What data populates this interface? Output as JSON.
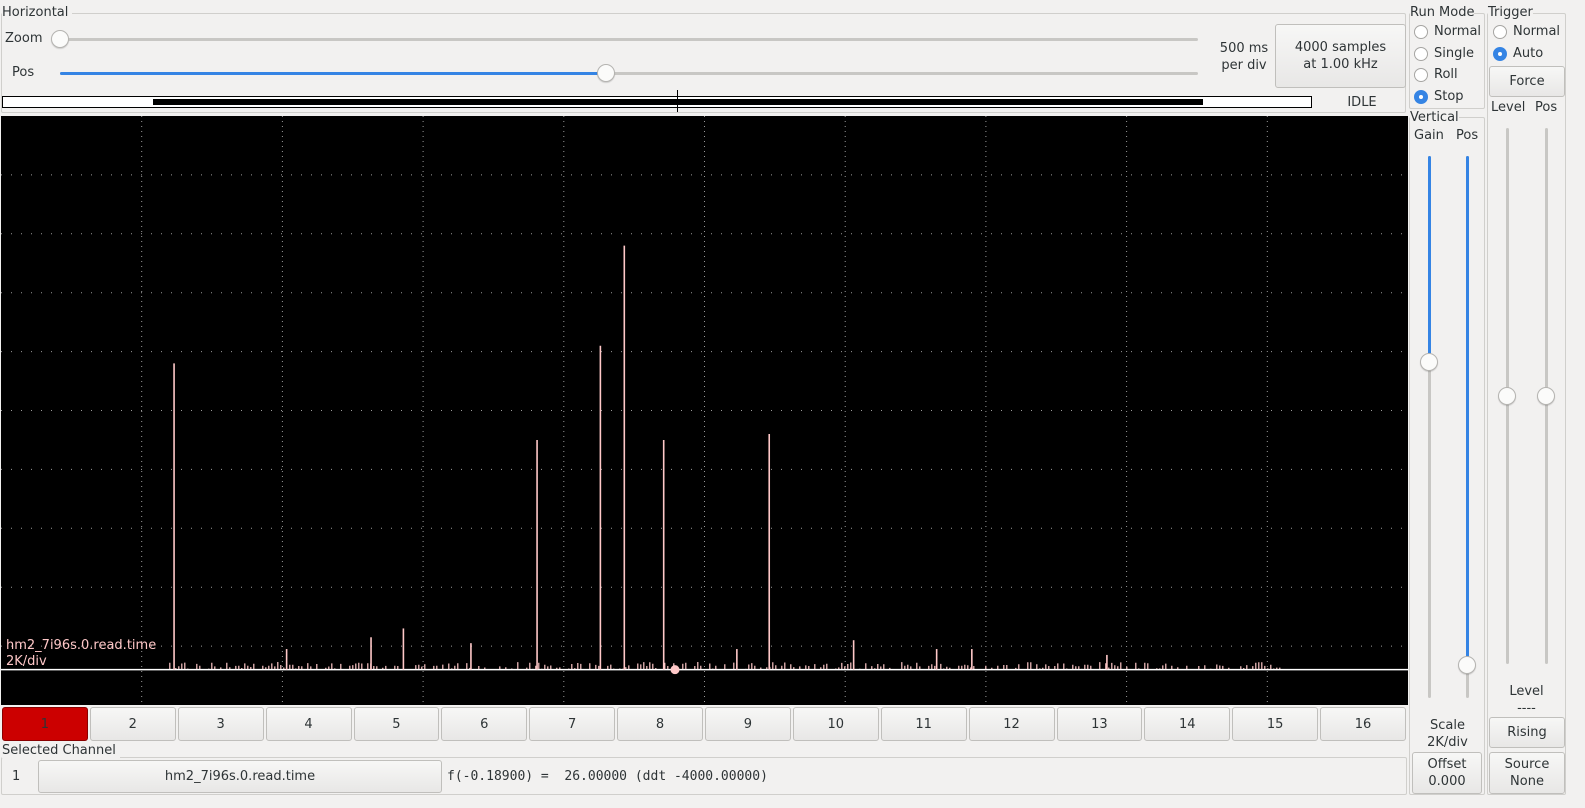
{
  "horizontal": {
    "title": "Horizontal",
    "zoom_label": "Zoom",
    "pos_label": "Pos",
    "zoom_value": 0.0,
    "pos_value": 0.48,
    "per_div_line1": "500 ms",
    "per_div_line2": "per div",
    "samples_line1": "4000 samples",
    "samples_line2": "at 1.00 kHz",
    "status": "IDLE"
  },
  "run_mode": {
    "title": "Run Mode",
    "options": [
      "Normal",
      "Single",
      "Roll",
      "Stop"
    ],
    "selected": "Stop"
  },
  "trigger": {
    "title": "Trigger",
    "options": [
      "Normal",
      "Auto"
    ],
    "selected": "Auto",
    "force_label": "Force",
    "level_label": "Level",
    "pos_label": "Pos",
    "level_value": 0.5,
    "pos_value": 0.5,
    "level_readout_label": "Level",
    "level_readout_value": "----",
    "edge_label": "Rising",
    "source_line1": "Source",
    "source_line2": "None"
  },
  "vertical": {
    "title": "Vertical",
    "gain_label": "Gain",
    "pos_label": "Pos",
    "gain_value": 0.62,
    "pos_value": 0.06,
    "scale_line1": "Scale",
    "scale_line2": "2K/div",
    "offset_line1": "Offset",
    "offset_line2": "0.000"
  },
  "scope": {
    "trace_name": "hm2_7i96s.0.read.time",
    "trace_scale": "2K/div",
    "colors": {
      "background": "#000000",
      "trace": "#ffc8c8",
      "grid": "#9a9a9a",
      "baseline": "#ffffff"
    }
  },
  "channels": {
    "labels": [
      "1",
      "2",
      "3",
      "4",
      "5",
      "6",
      "7",
      "8",
      "9",
      "10",
      "11",
      "12",
      "13",
      "14",
      "15",
      "16"
    ],
    "active": "1",
    "active_color": "#cc0000"
  },
  "selected_channel": {
    "title": "Selected Channel",
    "number": "1",
    "name": "hm2_7i96s.0.read.time",
    "readout": "f(-0.18900) =  26.00000 (ddt -4000.00000)"
  },
  "chart_data": {
    "type": "line",
    "x_range": [
      0,
      10
    ],
    "y_divisions": 10,
    "x_divisions": 10,
    "baseline_div_from_bottom": 0.6,
    "grid": true,
    "spikes": [
      {
        "x": 1.23,
        "div": 5.2
      },
      {
        "x": 3.81,
        "div": 3.9
      },
      {
        "x": 4.26,
        "div": 5.5
      },
      {
        "x": 4.43,
        "div": 7.2
      },
      {
        "x": 4.71,
        "div": 3.9
      },
      {
        "x": 5.46,
        "div": 4.0
      },
      {
        "x": 2.86,
        "div": 0.7
      },
      {
        "x": 2.63,
        "div": 0.55
      },
      {
        "x": 3.34,
        "div": 0.45
      },
      {
        "x": 6.06,
        "div": 0.5
      },
      {
        "x": 6.65,
        "div": 0.35
      },
      {
        "x": 6.9,
        "div": 0.35
      },
      {
        "x": 2.03,
        "div": 0.35
      },
      {
        "x": 5.23,
        "div": 0.35
      },
      {
        "x": 7.86,
        "div": 0.25
      }
    ]
  }
}
